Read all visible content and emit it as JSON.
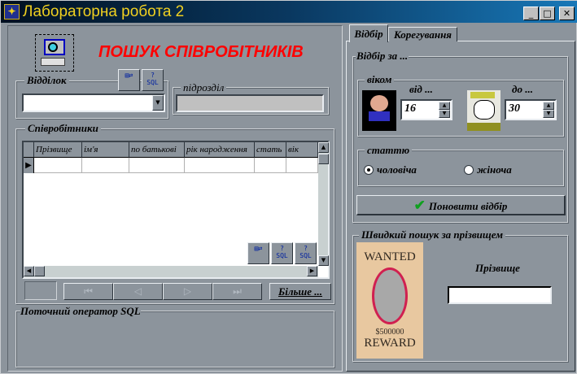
{
  "window": {
    "title": "Лабораторна робота 2",
    "app_icon": "delphi-icon",
    "controls": [
      "minimize-icon",
      "maximize-icon",
      "close-icon"
    ]
  },
  "left": {
    "heading": "ПОШУК СПІВРОБІТНИКІВ",
    "heading_color": "#ff0000",
    "department": {
      "label": "Відділок",
      "value": ""
    },
    "subdivision": {
      "label": "підрозділ",
      "value": ""
    },
    "toolbar_sql": "SQL",
    "employees": {
      "label": "Співробітники",
      "columns": [
        "Прізвище",
        "ім'я",
        "по батькові",
        "рік народження",
        "стать",
        "вік"
      ],
      "rows": [
        [
          "",
          "",
          "",
          "",
          "",
          ""
        ]
      ]
    },
    "navigator": {
      "first": "⏮",
      "prior": "◁",
      "next": "▷",
      "last": "⏭"
    },
    "more_button": "Більше ...",
    "sql_group": {
      "label": "Поточний оператор SQL",
      "text": ""
    }
  },
  "right": {
    "tabs": [
      {
        "label": "Відбір",
        "active": true
      },
      {
        "label": "Корегування",
        "active": false
      }
    ],
    "filter_group": "Відбір за ...",
    "age": {
      "label": "віком",
      "from_label": "від ...",
      "from_value": "16",
      "to_label": "до ...",
      "to_value": "30"
    },
    "gender": {
      "label": "статтю",
      "options": [
        {
          "label": "чоловіча",
          "checked": true
        },
        {
          "label": "жіноча",
          "checked": false
        }
      ]
    },
    "refresh_button": "Поновити відбір",
    "quick_search": {
      "label": "Швидкий пошук за прізвищем",
      "field_label": "Прізвище",
      "value": "",
      "poster": {
        "top": "WANTED",
        "amount": "$500000",
        "bottom": "REWARD"
      }
    }
  }
}
